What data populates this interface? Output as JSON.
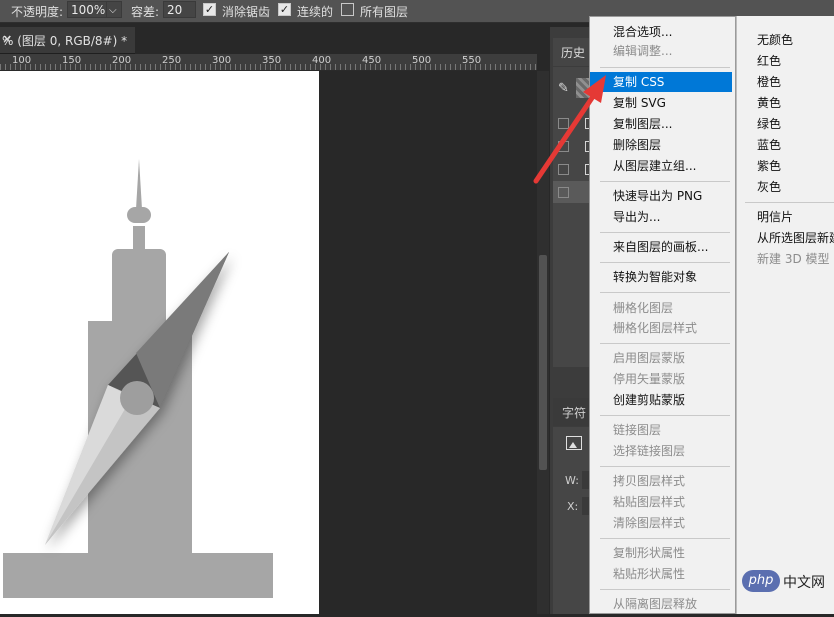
{
  "options_bar": {
    "opacity_label": "不透明度:",
    "opacity_value": "100%",
    "tolerance_label": "容差:",
    "tolerance_value": "20",
    "antialias_check": "✓",
    "antialias_label": "消除锯齿",
    "contiguous_check": "✓",
    "contiguous_label": "连续的",
    "all_layers_label": "所有图层",
    "dropdown_glyph": "⌵"
  },
  "document_tab": {
    "title": "% (图层 0, RGB/8#) *",
    "close": "×"
  },
  "ruler": {
    "labels": [
      "100",
      "150",
      "200",
      "250",
      "300",
      "350",
      "400",
      "450",
      "500",
      "550"
    ]
  },
  "panels": {
    "history_tab": "历史",
    "character_tab": "字符",
    "brush_icon_glyph": "✎",
    "w_label": "W:",
    "x_label": "X:"
  },
  "context_menu": {
    "items": [
      {
        "label": "混合选项...",
        "enabled": true
      },
      {
        "label": "编辑调整...",
        "enabled": false
      },
      {
        "label": "复制 CSS",
        "enabled": true,
        "highlighted": true
      },
      {
        "label": "复制 SVG",
        "enabled": true
      },
      {
        "label": "复制图层...",
        "enabled": true
      },
      {
        "label": "删除图层",
        "enabled": true
      },
      {
        "label": "从图层建立组...",
        "enabled": true
      },
      {
        "label": "快速导出为 PNG",
        "enabled": true
      },
      {
        "label": "导出为...",
        "enabled": true
      },
      {
        "label": "来自图层的画板...",
        "enabled": true
      },
      {
        "label": "转换为智能对象",
        "enabled": true
      },
      {
        "label": "栅格化图层",
        "enabled": false
      },
      {
        "label": "栅格化图层样式",
        "enabled": false
      },
      {
        "label": "启用图层蒙版",
        "enabled": false
      },
      {
        "label": "停用矢量蒙版",
        "enabled": false
      },
      {
        "label": "创建剪贴蒙版",
        "enabled": true
      },
      {
        "label": "链接图层",
        "enabled": false
      },
      {
        "label": "选择链接图层",
        "enabled": false
      },
      {
        "label": "拷贝图层样式",
        "enabled": false
      },
      {
        "label": "粘贴图层样式",
        "enabled": false
      },
      {
        "label": "清除图层样式",
        "enabled": false
      },
      {
        "label": "复制形状属性",
        "enabled": false
      },
      {
        "label": "粘贴形状属性",
        "enabled": false
      },
      {
        "label": "从隔离图层释放",
        "enabled": false
      }
    ]
  },
  "color_submenu": {
    "items": [
      {
        "label": "无颜色",
        "enabled": true
      },
      {
        "label": "红色",
        "enabled": true
      },
      {
        "label": "橙色",
        "enabled": true
      },
      {
        "label": "黄色",
        "enabled": true
      },
      {
        "label": "绿色",
        "enabled": true
      },
      {
        "label": "蓝色",
        "enabled": true
      },
      {
        "label": "紫色",
        "enabled": true
      },
      {
        "label": "灰色",
        "enabled": true
      },
      {
        "label": "明信片",
        "enabled": true
      },
      {
        "label": "从所选图层新建",
        "enabled": true
      },
      {
        "label": "新建 3D 模型",
        "enabled": false
      }
    ]
  },
  "watermark": {
    "logo_text": "php",
    "site_text": "中文网"
  },
  "colors": {
    "menu_highlight": "#0078d7",
    "arrow": "#e53935",
    "shape_light": "#a6a6a6",
    "shape_dark": "#555555"
  }
}
